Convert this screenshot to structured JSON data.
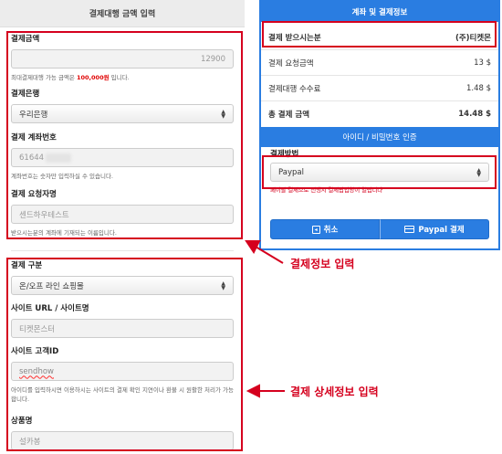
{
  "left": {
    "header": "결제대행 금액 입력",
    "amount": {
      "label": "결제금액",
      "value": "12900",
      "help_prefix": "최대결제대행 가능 금액은 ",
      "help_amount": "100,000원",
      "help_suffix": " 입니다."
    },
    "bank": {
      "label": "결제은행",
      "value": "우리은행"
    },
    "account": {
      "label": "결제 계좌번호",
      "value": "61644",
      "help": "계좌번호는 숫자만 입력하실 수 있습니다."
    },
    "requester": {
      "label": "결제 요청자명",
      "value": "센드하우테스트",
      "help": "받으시는분의 계좌에 기재되는 이름입니다."
    },
    "category": {
      "label": "결제 구분",
      "value": "온/오프 라인 쇼핑몰"
    },
    "site": {
      "label": "사이트 URL / 사이트명",
      "value": "티켓몬스터"
    },
    "site_id": {
      "label": "사이트 고객ID",
      "value": "sendhow",
      "help": "아이디를 입력하시면 이용하시는 사이트의 결제 확인 지연이나 환불 시 원활한 처리가 가능합니다."
    },
    "product": {
      "label": "상품명",
      "value": "설카봉"
    }
  },
  "right": {
    "header": "계좌 및 결제정보",
    "recipient": {
      "label": "결제 받으시는분",
      "value": "(주)티켓몬"
    },
    "rows": [
      {
        "label": "결제 요청금액",
        "value": "13 $"
      },
      {
        "label": "결제대행 수수료",
        "value": "1.48 $"
      }
    ],
    "total": {
      "label": "총 결제 금액",
      "value": "14.48 $"
    },
    "auth_header": "아이디 / 비밀번호 인증",
    "payment_method": {
      "label": "결제방법",
      "value": "Paypal",
      "note": "페이팔 결제으로 진행시 결제팝업창이 열립니다"
    },
    "buttons": {
      "cancel": "취소",
      "paypal": "Paypal 결제"
    }
  },
  "annotations": {
    "payment_info": "결제정보 입력",
    "payment_detail": "결제 상세정보 입력"
  },
  "colors": {
    "accent": "#2a7de1",
    "annotation": "#d5001e"
  }
}
